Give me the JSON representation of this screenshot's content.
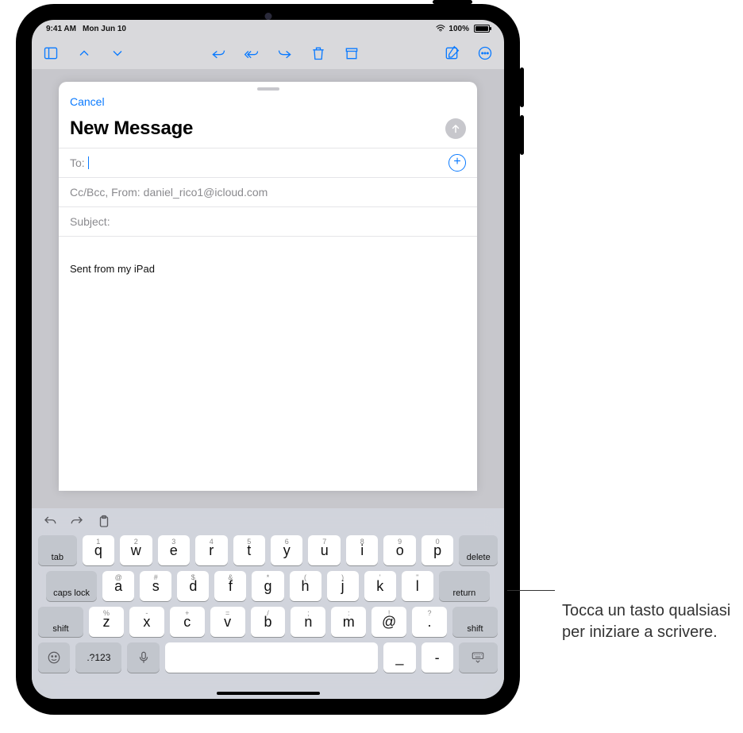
{
  "status": {
    "time": "9:41 AM",
    "date": "Mon Jun 10",
    "battery": "100%"
  },
  "compose": {
    "cancel": "Cancel",
    "title": "New Message",
    "to_label": "To:",
    "cc_label": "Cc/Bcc, From:",
    "from_email": "daniel_rico1@icloud.com",
    "subject_label": "Subject:",
    "body": "Sent from my iPad"
  },
  "keyboard": {
    "row1_hints": [
      "1",
      "2",
      "3",
      "4",
      "5",
      "6",
      "7",
      "8",
      "9",
      "0"
    ],
    "row1": [
      "q",
      "w",
      "e",
      "r",
      "t",
      "y",
      "u",
      "i",
      "o",
      "p"
    ],
    "row2_hints": [
      "@",
      "#",
      "$",
      "&",
      "*",
      "(",
      ")",
      "'",
      "\""
    ],
    "row2": [
      "a",
      "s",
      "d",
      "f",
      "g",
      "h",
      "j",
      "k",
      "l"
    ],
    "row3_hints": [
      "%",
      "-",
      "+",
      "=",
      "/",
      ";",
      ":",
      "!",
      "?"
    ],
    "row3": [
      "z",
      "x",
      "c",
      "v",
      "b",
      "n",
      "m",
      "@",
      "."
    ],
    "row4_underscore": "_",
    "row4_dash": "-",
    "tab": "tab",
    "delete": "delete",
    "caps": "caps lock",
    "ret": "return",
    "shift": "shift",
    "numkey": ".?123"
  },
  "callout": "Tocca un tasto qualsiasi per iniziare a scrivere."
}
